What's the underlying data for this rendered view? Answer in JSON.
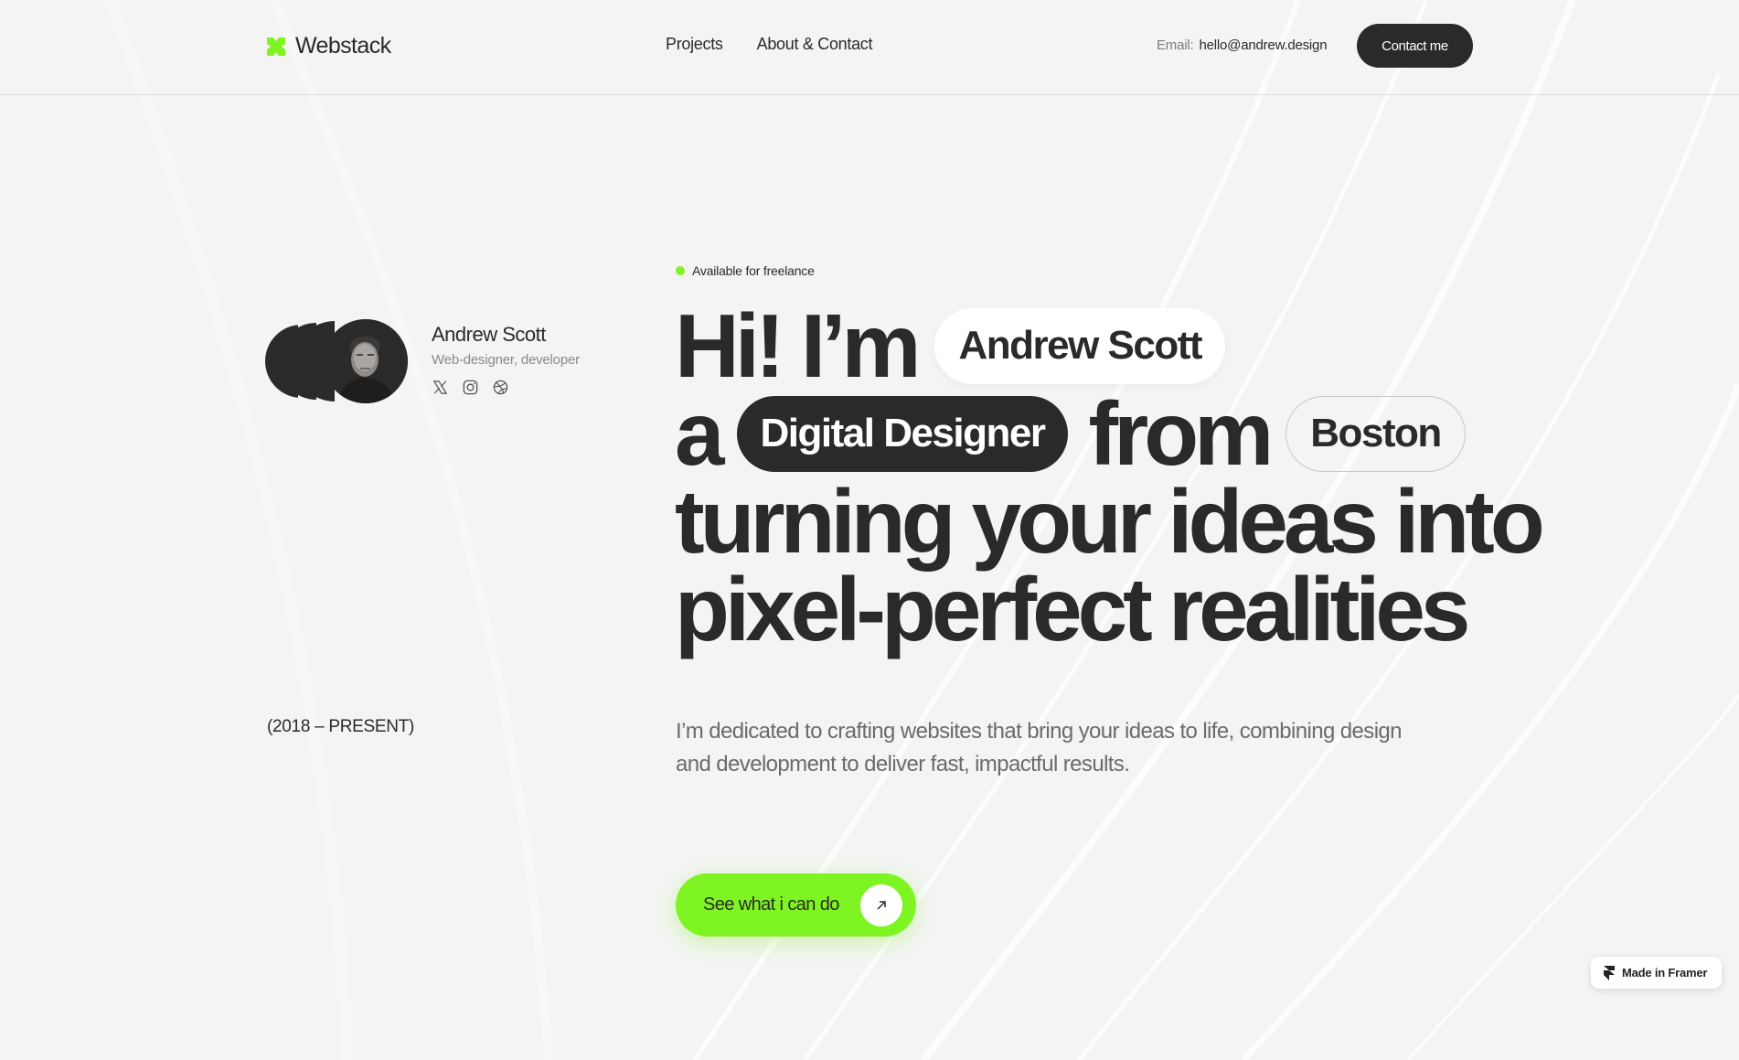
{
  "brand": {
    "name": "Webstack",
    "accent": "#7ef522",
    "dark": "#2b2a29"
  },
  "nav": {
    "items": [
      {
        "label": "Projects"
      },
      {
        "label": "About & Contact"
      }
    ]
  },
  "header": {
    "email_label": "Email:",
    "email_value": "hello@andrew.design",
    "contact_button": "Contact me"
  },
  "profile": {
    "name": "Andrew Scott",
    "role": "Web-designer, developer",
    "socials": [
      "x-icon",
      "instagram-icon",
      "dribbble-icon"
    ],
    "period": "(2018 – PRESENT)"
  },
  "hero": {
    "status": "Available for freelance",
    "line1_prefix": "Hi! I’m",
    "name_pill": "Andrew Scott",
    "line2_prefix": "a",
    "role_pill": "Digital Designer",
    "line2_mid": "from",
    "city_pill": "Boston",
    "line3": "turning your ideas into",
    "line4": "pixel-perfect realities",
    "description": "I’m dedicated to crafting websites that bring your ideas to life, combining design and development to deliver fast, impactful results.",
    "cta_label": "See what i can do"
  },
  "badge": {
    "label": "Made in Framer"
  }
}
